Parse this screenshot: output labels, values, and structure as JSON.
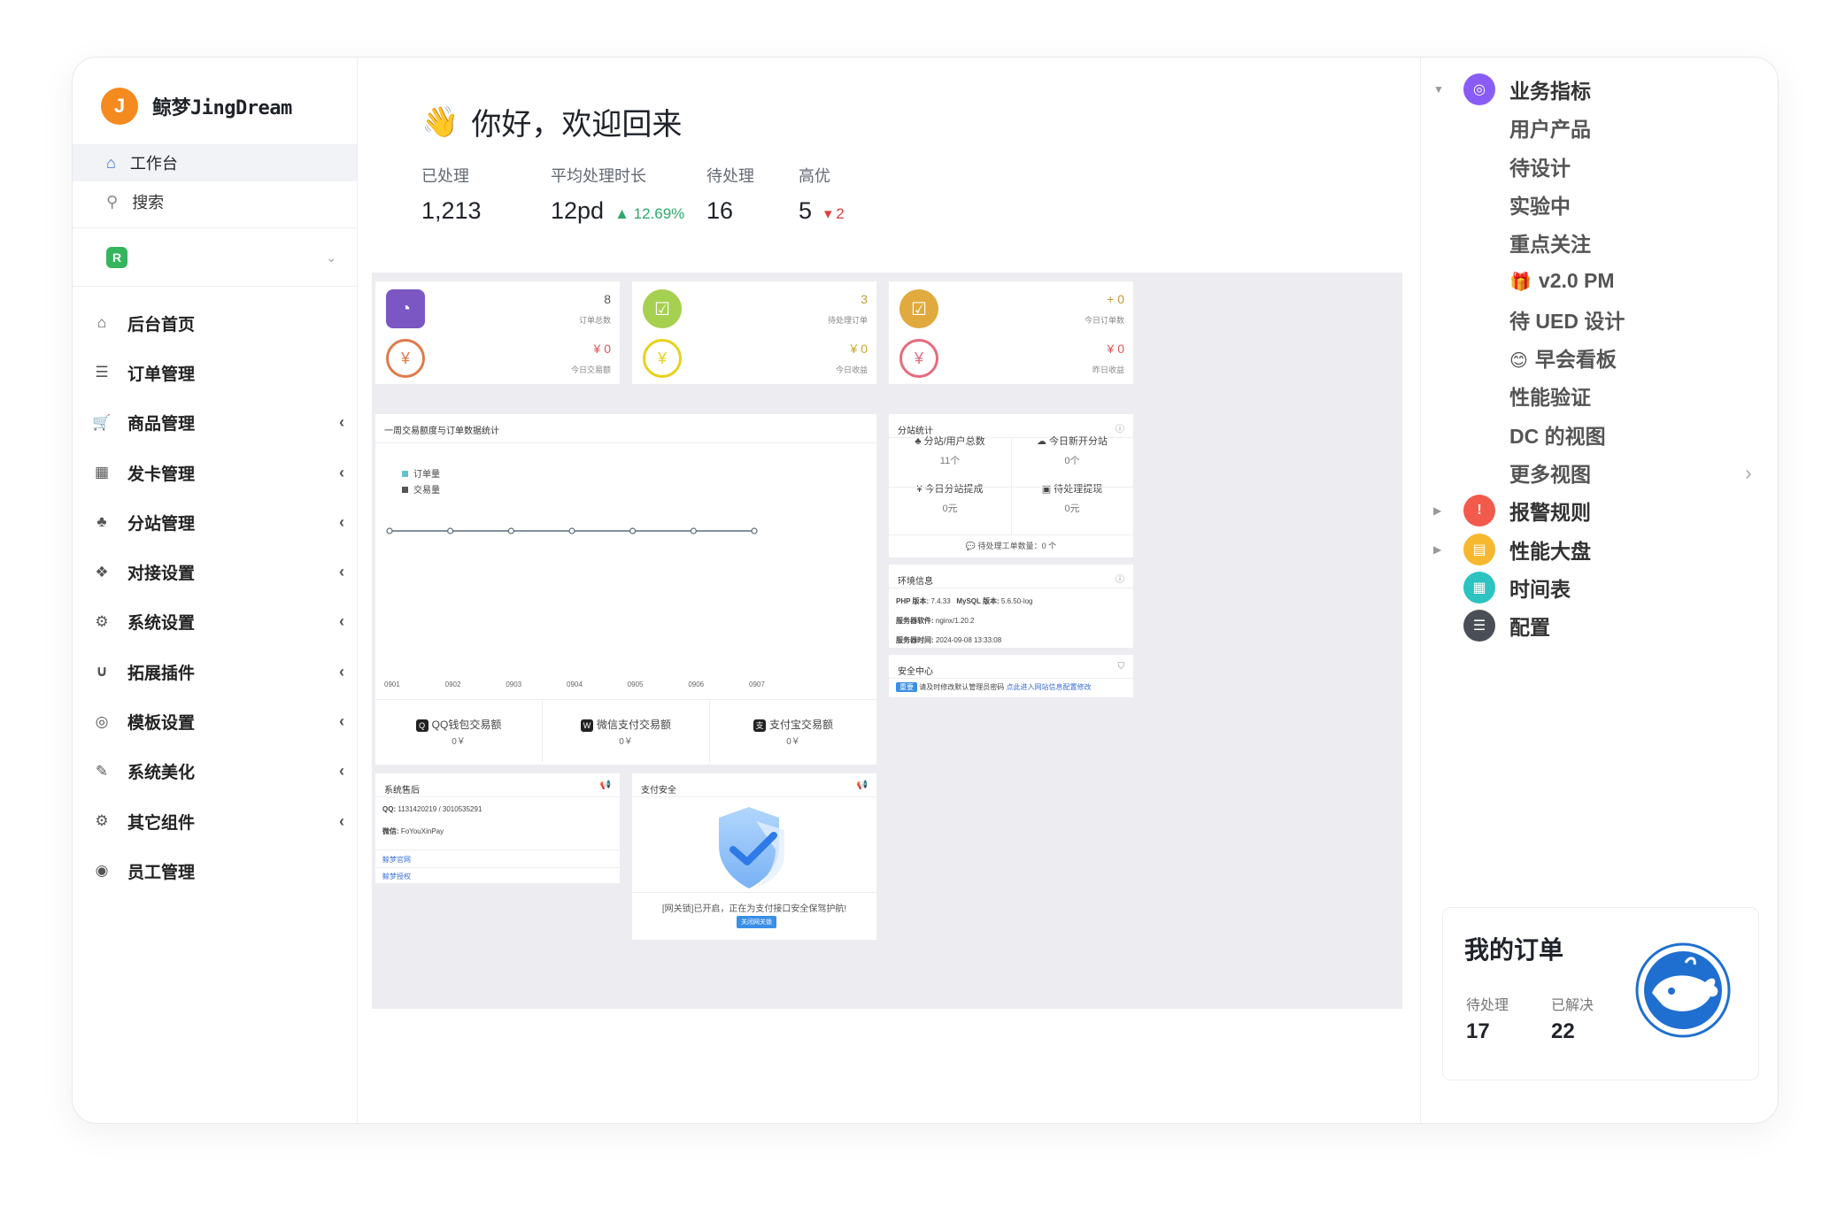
{
  "brand": {
    "avatar": "J",
    "name": "鲸梦JingDream"
  },
  "nav": {
    "workspace": "工作台",
    "search": "搜索",
    "role_badge": "R"
  },
  "menu": [
    {
      "label": "后台首页",
      "icon": "home-icon",
      "glyph": "⌂",
      "arrow": ""
    },
    {
      "label": "订单管理",
      "icon": "list-icon",
      "glyph": "☰",
      "arrow": ""
    },
    {
      "label": "商品管理",
      "icon": "cart-icon",
      "glyph": "🛒",
      "arrow": "‹"
    },
    {
      "label": "发卡管理",
      "icon": "grid-icon",
      "glyph": "▦",
      "arrow": "‹"
    },
    {
      "label": "分站管理",
      "icon": "sitemap-icon",
      "glyph": "♣",
      "arrow": "‹"
    },
    {
      "label": "对接设置",
      "icon": "cubes-icon",
      "glyph": "❖",
      "arrow": "‹"
    },
    {
      "label": "系统设置",
      "icon": "gear-icon",
      "glyph": "⚙",
      "arrow": "‹"
    },
    {
      "label": "拓展插件",
      "icon": "magnet-icon",
      "glyph": "∪",
      "arrow": "‹"
    },
    {
      "label": "模板设置",
      "icon": "compass-icon",
      "glyph": "◎",
      "arrow": "‹"
    },
    {
      "label": "系统美化",
      "icon": "brush-icon",
      "glyph": "✎",
      "arrow": "‹"
    },
    {
      "label": "其它组件",
      "icon": "cogs-icon",
      "glyph": "⚙",
      "arrow": "‹"
    },
    {
      "label": "员工管理",
      "icon": "user-icon",
      "glyph": "◉",
      "arrow": ""
    }
  ],
  "header": {
    "greeting": "你好，欢迎回来",
    "hand": "👋"
  },
  "stats": [
    {
      "label": "已处理",
      "value": "1,213",
      "delta": "",
      "dir": ""
    },
    {
      "label": "平均处理时长",
      "value": "12pd",
      "delta": "▲ 12.69%",
      "dir": "up"
    },
    {
      "label": "待处理",
      "value": "16",
      "delta": "",
      "dir": ""
    },
    {
      "label": "高优",
      "value": "5",
      "delta": "▾ 2",
      "dir": "down"
    }
  ],
  "kpis": [
    {
      "value": "8",
      "label": "订单总数",
      "color": "#7b57c4",
      "num_color": "#555",
      "shape": "square",
      "glyph": "◔"
    },
    {
      "value": "3",
      "label": "待处理订单",
      "color": "#a6d04f",
      "num_color": "#b8a033",
      "shape": "circle",
      "glyph": "☑"
    },
    {
      "value": "+ 0",
      "label": "今日订单数",
      "color": "#e0aa3e",
      "num_color": "#c59a2e",
      "shape": "circle",
      "glyph": "☑"
    },
    {
      "value": "¥ 0",
      "label": "今日交易额",
      "color": "#e07a4b",
      "num_color": "#e05555",
      "shape": "ring",
      "glyph": "¥"
    },
    {
      "value": "¥ 0",
      "label": "今日收益",
      "color": "#e6d21a",
      "num_color": "#c9a822",
      "shape": "ring",
      "glyph": "¥"
    },
    {
      "value": "¥ 0",
      "label": "昨日收益",
      "color": "#e56b7d",
      "num_color": "#e05555",
      "shape": "ring",
      "glyph": "¥"
    }
  ],
  "chart": {
    "title": "一周交易额度与订单数据统计",
    "legend": [
      "订单量",
      "交易量"
    ],
    "legend_colors": [
      "#5fc4cc",
      "#555555"
    ]
  },
  "chart_data": {
    "type": "line",
    "title": "一周交易额度与订单数据统计",
    "x": [
      "0901",
      "0902",
      "0903",
      "0904",
      "0905",
      "0906",
      "0907"
    ],
    "series": [
      {
        "name": "订单量",
        "values": [
          0,
          0,
          0,
          0,
          0,
          0,
          0
        ]
      },
      {
        "name": "交易量",
        "values": [
          0,
          0,
          0,
          0,
          0,
          0,
          0
        ]
      }
    ]
  },
  "payments": [
    {
      "label": "QQ钱包交易额",
      "value": "0￥",
      "icon": "qq-icon",
      "glyph": "Q"
    },
    {
      "label": "微信支付交易额",
      "value": "0￥",
      "icon": "wechat-icon",
      "glyph": "W"
    },
    {
      "label": "支付宝交易额",
      "value": "0￥",
      "icon": "alipay-icon",
      "glyph": "支"
    }
  ],
  "branch": {
    "title": "分站统计",
    "items": [
      {
        "label": "分站/用户总数",
        "value": "11个",
        "glyph": "♣"
      },
      {
        "label": "今日新开分站",
        "value": "0个",
        "glyph": "☁"
      },
      {
        "label": "今日分站提成",
        "value": "0元",
        "glyph": "¥"
      },
      {
        "label": "待处理提现",
        "value": "0元",
        "glyph": "▣"
      }
    ],
    "footer": "待处理工单数量：0 个"
  },
  "env": {
    "title": "环境信息",
    "php_label": "PHP 版本:",
    "php": "7.4.33",
    "mysql_label": "MySQL 版本:",
    "mysql": "5.6.50-log",
    "software_label": "服务器软件:",
    "software": "nginx/1.20.2",
    "time_label": "服务器时间:",
    "time": "2024-09-08 13:33:08"
  },
  "security": {
    "title": "安全中心",
    "badge": "重要",
    "text": "请及时修改默认管理员密码",
    "link": "点此进入网站信息配置修改"
  },
  "after_sale": {
    "title": "系统售后",
    "qq_label": "QQ:",
    "qq": "1131420219 / 3010535291",
    "wechat_label": "微信:",
    "wechat": "FoYouXinPay",
    "links": [
      "鲸梦官网",
      "鲸梦授权"
    ]
  },
  "pay_security": {
    "title": "支付安全",
    "text": "[网关锁]已开启，正在为支付接口安全保驾护航!",
    "button": "关闭网关锁"
  },
  "right": {
    "items": [
      {
        "label": "业务指标",
        "bub": "#8a5cf6",
        "glyph": "◎",
        "tri": "▼",
        "sub": false
      },
      {
        "label": "用户产品",
        "sub": true
      },
      {
        "label": "待设计",
        "sub": true
      },
      {
        "label": "实验中",
        "sub": true
      },
      {
        "label": "重点关注",
        "sub": true
      },
      {
        "label": "v2.0 PM",
        "sub": true,
        "emoji": "🎁"
      },
      {
        "label": "待 UED 设计",
        "sub": true
      },
      {
        "label": "早会看板",
        "sub": true,
        "emoji": "😊"
      },
      {
        "label": "性能验证",
        "sub": true
      },
      {
        "label": "DC 的视图",
        "sub": true
      },
      {
        "label": "更多视图",
        "sub": true,
        "chev": "›"
      },
      {
        "label": "报警规则",
        "bub": "#f25a4b",
        "glyph": "!",
        "tri": "▶",
        "sub": false
      },
      {
        "label": "性能大盘",
        "bub": "#f5b82e",
        "glyph": "▤",
        "tri": "▶",
        "sub": false
      },
      {
        "label": "时间表",
        "bub": "#2cc3c0",
        "glyph": "▦",
        "tri": "",
        "sub": false
      },
      {
        "label": "配置",
        "bub": "#4a4f57",
        "glyph": "☰",
        "tri": "",
        "sub": false
      }
    ]
  },
  "orders": {
    "title": "我的订单",
    "pending_label": "待处理",
    "pending": "17",
    "solved_label": "已解决",
    "solved": "22"
  }
}
